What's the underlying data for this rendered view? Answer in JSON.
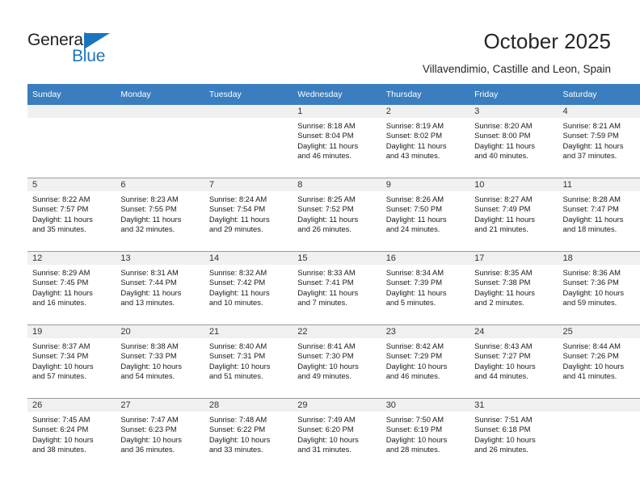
{
  "brand": {
    "name_part1": "General",
    "name_part2": "Blue",
    "accent_color": "#1b75bc"
  },
  "header": {
    "title": "October 2025",
    "subtitle": "Villavendimio, Castille and Leon, Spain"
  },
  "calendar": {
    "header_bg": "#3a7ebf",
    "daynum_bg": "#f0f0f0",
    "weekday_headers": [
      "Sunday",
      "Monday",
      "Tuesday",
      "Wednesday",
      "Thursday",
      "Friday",
      "Saturday"
    ],
    "weeks": [
      [
        {
          "day": "",
          "sunrise": "",
          "sunset": "",
          "daylight_line1": "",
          "daylight_line2": ""
        },
        {
          "day": "",
          "sunrise": "",
          "sunset": "",
          "daylight_line1": "",
          "daylight_line2": ""
        },
        {
          "day": "",
          "sunrise": "",
          "sunset": "",
          "daylight_line1": "",
          "daylight_line2": ""
        },
        {
          "day": "1",
          "sunrise": "Sunrise: 8:18 AM",
          "sunset": "Sunset: 8:04 PM",
          "daylight_line1": "Daylight: 11 hours",
          "daylight_line2": "and 46 minutes."
        },
        {
          "day": "2",
          "sunrise": "Sunrise: 8:19 AM",
          "sunset": "Sunset: 8:02 PM",
          "daylight_line1": "Daylight: 11 hours",
          "daylight_line2": "and 43 minutes."
        },
        {
          "day": "3",
          "sunrise": "Sunrise: 8:20 AM",
          "sunset": "Sunset: 8:00 PM",
          "daylight_line1": "Daylight: 11 hours",
          "daylight_line2": "and 40 minutes."
        },
        {
          "day": "4",
          "sunrise": "Sunrise: 8:21 AM",
          "sunset": "Sunset: 7:59 PM",
          "daylight_line1": "Daylight: 11 hours",
          "daylight_line2": "and 37 minutes."
        }
      ],
      [
        {
          "day": "5",
          "sunrise": "Sunrise: 8:22 AM",
          "sunset": "Sunset: 7:57 PM",
          "daylight_line1": "Daylight: 11 hours",
          "daylight_line2": "and 35 minutes."
        },
        {
          "day": "6",
          "sunrise": "Sunrise: 8:23 AM",
          "sunset": "Sunset: 7:55 PM",
          "daylight_line1": "Daylight: 11 hours",
          "daylight_line2": "and 32 minutes."
        },
        {
          "day": "7",
          "sunrise": "Sunrise: 8:24 AM",
          "sunset": "Sunset: 7:54 PM",
          "daylight_line1": "Daylight: 11 hours",
          "daylight_line2": "and 29 minutes."
        },
        {
          "day": "8",
          "sunrise": "Sunrise: 8:25 AM",
          "sunset": "Sunset: 7:52 PM",
          "daylight_line1": "Daylight: 11 hours",
          "daylight_line2": "and 26 minutes."
        },
        {
          "day": "9",
          "sunrise": "Sunrise: 8:26 AM",
          "sunset": "Sunset: 7:50 PM",
          "daylight_line1": "Daylight: 11 hours",
          "daylight_line2": "and 24 minutes."
        },
        {
          "day": "10",
          "sunrise": "Sunrise: 8:27 AM",
          "sunset": "Sunset: 7:49 PM",
          "daylight_line1": "Daylight: 11 hours",
          "daylight_line2": "and 21 minutes."
        },
        {
          "day": "11",
          "sunrise": "Sunrise: 8:28 AM",
          "sunset": "Sunset: 7:47 PM",
          "daylight_line1": "Daylight: 11 hours",
          "daylight_line2": "and 18 minutes."
        }
      ],
      [
        {
          "day": "12",
          "sunrise": "Sunrise: 8:29 AM",
          "sunset": "Sunset: 7:45 PM",
          "daylight_line1": "Daylight: 11 hours",
          "daylight_line2": "and 16 minutes."
        },
        {
          "day": "13",
          "sunrise": "Sunrise: 8:31 AM",
          "sunset": "Sunset: 7:44 PM",
          "daylight_line1": "Daylight: 11 hours",
          "daylight_line2": "and 13 minutes."
        },
        {
          "day": "14",
          "sunrise": "Sunrise: 8:32 AM",
          "sunset": "Sunset: 7:42 PM",
          "daylight_line1": "Daylight: 11 hours",
          "daylight_line2": "and 10 minutes."
        },
        {
          "day": "15",
          "sunrise": "Sunrise: 8:33 AM",
          "sunset": "Sunset: 7:41 PM",
          "daylight_line1": "Daylight: 11 hours",
          "daylight_line2": "and 7 minutes."
        },
        {
          "day": "16",
          "sunrise": "Sunrise: 8:34 AM",
          "sunset": "Sunset: 7:39 PM",
          "daylight_line1": "Daylight: 11 hours",
          "daylight_line2": "and 5 minutes."
        },
        {
          "day": "17",
          "sunrise": "Sunrise: 8:35 AM",
          "sunset": "Sunset: 7:38 PM",
          "daylight_line1": "Daylight: 11 hours",
          "daylight_line2": "and 2 minutes."
        },
        {
          "day": "18",
          "sunrise": "Sunrise: 8:36 AM",
          "sunset": "Sunset: 7:36 PM",
          "daylight_line1": "Daylight: 10 hours",
          "daylight_line2": "and 59 minutes."
        }
      ],
      [
        {
          "day": "19",
          "sunrise": "Sunrise: 8:37 AM",
          "sunset": "Sunset: 7:34 PM",
          "daylight_line1": "Daylight: 10 hours",
          "daylight_line2": "and 57 minutes."
        },
        {
          "day": "20",
          "sunrise": "Sunrise: 8:38 AM",
          "sunset": "Sunset: 7:33 PM",
          "daylight_line1": "Daylight: 10 hours",
          "daylight_line2": "and 54 minutes."
        },
        {
          "day": "21",
          "sunrise": "Sunrise: 8:40 AM",
          "sunset": "Sunset: 7:31 PM",
          "daylight_line1": "Daylight: 10 hours",
          "daylight_line2": "and 51 minutes."
        },
        {
          "day": "22",
          "sunrise": "Sunrise: 8:41 AM",
          "sunset": "Sunset: 7:30 PM",
          "daylight_line1": "Daylight: 10 hours",
          "daylight_line2": "and 49 minutes."
        },
        {
          "day": "23",
          "sunrise": "Sunrise: 8:42 AM",
          "sunset": "Sunset: 7:29 PM",
          "daylight_line1": "Daylight: 10 hours",
          "daylight_line2": "and 46 minutes."
        },
        {
          "day": "24",
          "sunrise": "Sunrise: 8:43 AM",
          "sunset": "Sunset: 7:27 PM",
          "daylight_line1": "Daylight: 10 hours",
          "daylight_line2": "and 44 minutes."
        },
        {
          "day": "25",
          "sunrise": "Sunrise: 8:44 AM",
          "sunset": "Sunset: 7:26 PM",
          "daylight_line1": "Daylight: 10 hours",
          "daylight_line2": "and 41 minutes."
        }
      ],
      [
        {
          "day": "26",
          "sunrise": "Sunrise: 7:45 AM",
          "sunset": "Sunset: 6:24 PM",
          "daylight_line1": "Daylight: 10 hours",
          "daylight_line2": "and 38 minutes."
        },
        {
          "day": "27",
          "sunrise": "Sunrise: 7:47 AM",
          "sunset": "Sunset: 6:23 PM",
          "daylight_line1": "Daylight: 10 hours",
          "daylight_line2": "and 36 minutes."
        },
        {
          "day": "28",
          "sunrise": "Sunrise: 7:48 AM",
          "sunset": "Sunset: 6:22 PM",
          "daylight_line1": "Daylight: 10 hours",
          "daylight_line2": "and 33 minutes."
        },
        {
          "day": "29",
          "sunrise": "Sunrise: 7:49 AM",
          "sunset": "Sunset: 6:20 PM",
          "daylight_line1": "Daylight: 10 hours",
          "daylight_line2": "and 31 minutes."
        },
        {
          "day": "30",
          "sunrise": "Sunrise: 7:50 AM",
          "sunset": "Sunset: 6:19 PM",
          "daylight_line1": "Daylight: 10 hours",
          "daylight_line2": "and 28 minutes."
        },
        {
          "day": "31",
          "sunrise": "Sunrise: 7:51 AM",
          "sunset": "Sunset: 6:18 PM",
          "daylight_line1": "Daylight: 10 hours",
          "daylight_line2": "and 26 minutes."
        },
        {
          "day": "",
          "sunrise": "",
          "sunset": "",
          "daylight_line1": "",
          "daylight_line2": ""
        }
      ]
    ]
  }
}
